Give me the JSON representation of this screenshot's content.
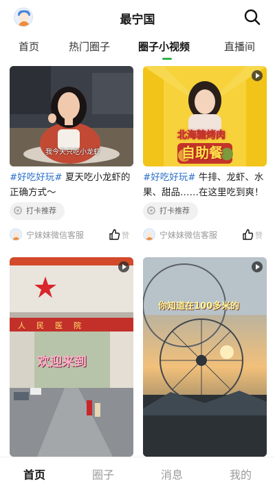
{
  "header": {
    "title": "最宁国"
  },
  "tabs": [
    {
      "label": "首页"
    },
    {
      "label": "热门圈子"
    },
    {
      "label": "圈子小视频"
    },
    {
      "label": "直播间"
    }
  ],
  "active_tab": "圈子小视频",
  "cards": [
    {
      "tag": "#好吃好玩#",
      "text": " 夏天吃小龙虾的正确方式～",
      "caption": "我今天只吃小龙虾",
      "chip": "打卡推荐",
      "author": "宁妹妹微信客服",
      "like": "赞"
    },
    {
      "tag": "#好吃好玩#",
      "text": " 牛排、龙虾、水果、甜品……在这里吃到爽！",
      "overlay_line1": "北海糖烤肉",
      "overlay_line2": "自助餐",
      "chip": "打卡推荐",
      "author": "宁妹妹微信客服",
      "like": "赞"
    },
    {
      "banner": "人民医院",
      "welcome": "欢迎来到"
    },
    {
      "overlay": "你知道在100多米的"
    }
  ],
  "bottom_nav": [
    {
      "label": "首页"
    },
    {
      "label": "圈子"
    },
    {
      "label": "消息"
    },
    {
      "label": "我的"
    }
  ],
  "colors": {
    "accent": "#2fb34a",
    "hashtag": "#2a6fc9",
    "muted": "#9a9a9a"
  }
}
